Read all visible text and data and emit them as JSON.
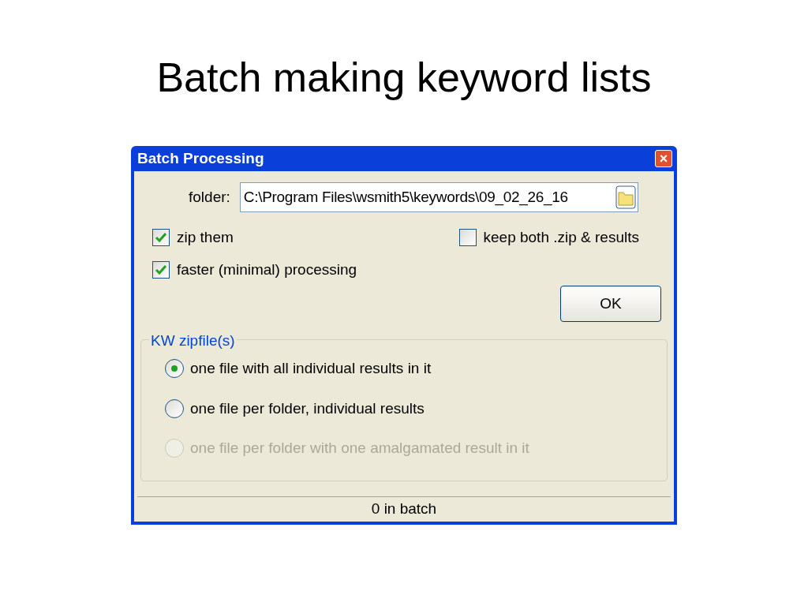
{
  "slide_title": "Batch making keyword lists",
  "window": {
    "title": "Batch Processing",
    "close": "×"
  },
  "folder": {
    "label": "folder:",
    "value": "C:\\Program Files\\wsmith5\\keywords\\09_02_26_16"
  },
  "checkboxes": [
    {
      "label": "zip them",
      "checked": true
    },
    {
      "label": "faster (minimal) processing",
      "checked": true
    },
    {
      "label": "keep both .zip & results",
      "checked": false
    }
  ],
  "ok_button": "OK",
  "group": {
    "title": "KW zipfile(s)",
    "options": [
      {
        "label": "one file with all individual results in it",
        "selected": true,
        "disabled": false
      },
      {
        "label": "one file per folder, individual results",
        "selected": false,
        "disabled": false
      },
      {
        "label": "one file per folder with one amalgamated result in it",
        "selected": false,
        "disabled": true
      }
    ]
  },
  "status_bar": "0 in batch"
}
